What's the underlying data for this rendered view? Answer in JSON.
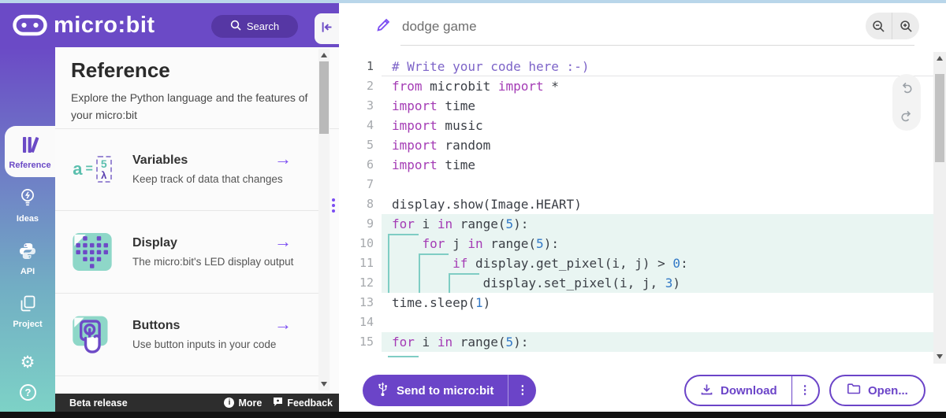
{
  "colors": {
    "brand_purple": "#6b4ac6",
    "accent_purple": "#7b4df2",
    "sidebar_teal": "#7dd2c6",
    "tile_teal": "#8ed7c8",
    "code_keyword": "#a43cb5",
    "code_comment": "#7d64c8",
    "code_number": "#3178c6",
    "block_highlight": "#e9f5f2",
    "indent_guide": "#7fcdc4"
  },
  "header": {
    "brand": "micro:bit",
    "search_label": "Search"
  },
  "sidebar": {
    "items": [
      {
        "id": "reference",
        "label": "Reference",
        "active": true
      },
      {
        "id": "ideas",
        "label": "Ideas",
        "active": false
      },
      {
        "id": "api",
        "label": "API",
        "active": false
      },
      {
        "id": "project",
        "label": "Project",
        "active": false
      }
    ]
  },
  "reference_panel": {
    "title": "Reference",
    "description": "Explore the Python language and the features of your micro:bit",
    "cards": [
      {
        "id": "variables",
        "title": "Variables",
        "subtitle": "Keep track of data that changes"
      },
      {
        "id": "display",
        "title": "Display",
        "subtitle": "The micro:bit's LED display output"
      },
      {
        "id": "buttons",
        "title": "Buttons",
        "subtitle": "Use button inputs in your code"
      }
    ]
  },
  "editor": {
    "project_name": "dodge game",
    "lines": [
      {
        "n": 1,
        "active": true,
        "hl": false,
        "tokens": [
          [
            "c",
            "# Write your code here :-)"
          ]
        ]
      },
      {
        "n": 2,
        "hl": false,
        "tokens": [
          [
            "k",
            "from"
          ],
          [
            "t",
            " microbit "
          ],
          [
            "k",
            "import"
          ],
          [
            "t",
            " *"
          ]
        ]
      },
      {
        "n": 3,
        "hl": false,
        "tokens": [
          [
            "k",
            "import"
          ],
          [
            "t",
            " time"
          ]
        ]
      },
      {
        "n": 4,
        "hl": false,
        "tokens": [
          [
            "k",
            "import"
          ],
          [
            "t",
            " music"
          ]
        ]
      },
      {
        "n": 5,
        "hl": false,
        "tokens": [
          [
            "k",
            "import"
          ],
          [
            "t",
            " random"
          ]
        ]
      },
      {
        "n": 6,
        "hl": false,
        "tokens": [
          [
            "k",
            "import"
          ],
          [
            "t",
            " time"
          ]
        ]
      },
      {
        "n": 7,
        "hl": false,
        "tokens": []
      },
      {
        "n": 8,
        "hl": false,
        "tokens": [
          [
            "t",
            "display.show(Image.HEART)"
          ]
        ]
      },
      {
        "n": 9,
        "hl": true,
        "tokens": [
          [
            "k",
            "for"
          ],
          [
            "t",
            " i "
          ],
          [
            "k",
            "in"
          ],
          [
            "t",
            " range("
          ],
          [
            "n",
            "5"
          ],
          [
            "t",
            "):"
          ]
        ]
      },
      {
        "n": 10,
        "hl": true,
        "gv": [
          0
        ],
        "gh": [
          0,
          4
        ],
        "tokens": [
          [
            "t",
            "    "
          ],
          [
            "k",
            "for"
          ],
          [
            "t",
            " j "
          ],
          [
            "k",
            "in"
          ],
          [
            "t",
            " range("
          ],
          [
            "n",
            "5"
          ],
          [
            "t",
            "):"
          ]
        ]
      },
      {
        "n": 11,
        "hl": true,
        "gv": [
          0,
          4
        ],
        "gh": [
          4,
          8
        ],
        "tokens": [
          [
            "t",
            "        "
          ],
          [
            "k",
            "if"
          ],
          [
            "t",
            " display.get_pixel(i, j) > "
          ],
          [
            "n",
            "0"
          ],
          [
            "t",
            ":"
          ]
        ]
      },
      {
        "n": 12,
        "hl": true,
        "gv": [
          0,
          4,
          8
        ],
        "gh": [
          8,
          12
        ],
        "tokens": [
          [
            "t",
            "            display.set_pixel(i, j, "
          ],
          [
            "n",
            "3"
          ],
          [
            "t",
            ")"
          ]
        ]
      },
      {
        "n": 13,
        "hl": false,
        "tokens": [
          [
            "t",
            "time.sleep("
          ],
          [
            "n",
            "1"
          ],
          [
            "t",
            ")"
          ]
        ]
      },
      {
        "n": 14,
        "hl": false,
        "tokens": []
      },
      {
        "n": 15,
        "hl": true,
        "ghb": [
          0,
          4
        ],
        "tokens": [
          [
            "k",
            "for"
          ],
          [
            "t",
            " i "
          ],
          [
            "k",
            "in"
          ],
          [
            "t",
            " range("
          ],
          [
            "n",
            "5"
          ],
          [
            "t",
            "):"
          ]
        ]
      }
    ]
  },
  "actions": {
    "send": "Send to micro:bit",
    "download": "Download",
    "open": "Open..."
  },
  "footer": {
    "beta": "Beta release",
    "more": "More",
    "feedback": "Feedback"
  },
  "icons": {
    "arrow": "→",
    "kebab": "⋮",
    "gear": "⚙",
    "help": "?",
    "info": "i"
  }
}
